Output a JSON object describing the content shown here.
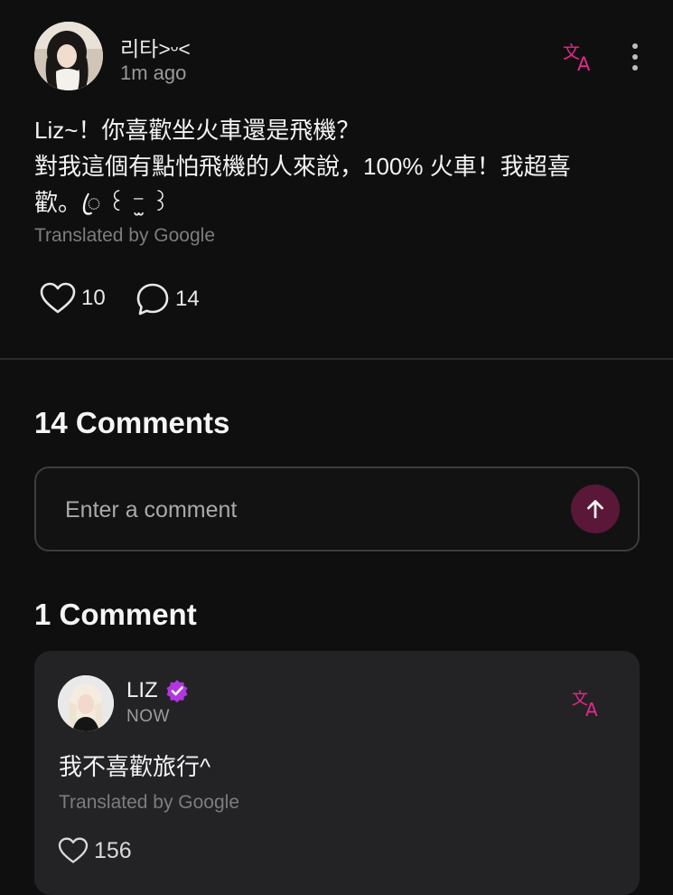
{
  "post": {
    "author_name": "리타>ᵕ<",
    "time": "1m ago",
    "body_lines": [
      "Liz~！你喜歡坐火車還是飛機？",
      "對我這個有點怕飛機的人來說，100% 火車！我超喜",
      "歡。ꦿ ꒰ ⁻̫ ꒱"
    ],
    "translated_by": "Translated by Google",
    "likes": "10",
    "comments": "14",
    "translate_icon": "translate-icon",
    "more_icon": "more-vertical-icon"
  },
  "comments_section": {
    "title": "14 Comments",
    "input_placeholder": "Enter a comment",
    "send_icon": "arrow-up-icon"
  },
  "artist_comments": {
    "title": "1 Comment",
    "items": [
      {
        "name": "LIZ",
        "verified": true,
        "time": "NOW",
        "text": "我不喜歡旅行^",
        "translated_by": "Translated by Google",
        "likes": "156"
      }
    ]
  },
  "colors": {
    "background": "#0f0f10",
    "accent": "#e5288c",
    "verified_badge": "#b236e0",
    "send_button": "#5b1737",
    "card": "#232325"
  }
}
